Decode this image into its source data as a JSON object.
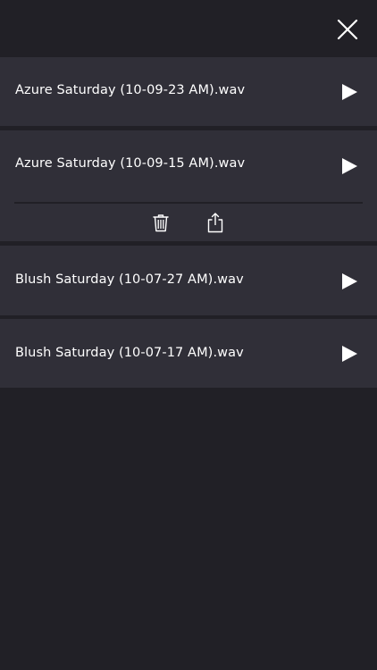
{
  "header": {
    "close_icon": "close-icon"
  },
  "recordings": [
    {
      "filename": "Azure Saturday (10-09-23 AM).wav",
      "expanded": false
    },
    {
      "filename": "Azure Saturday (10-09-15 AM).wav",
      "expanded": true
    },
    {
      "filename": "Blush Saturday (10-07-27 AM).wav",
      "expanded": false
    },
    {
      "filename": "Blush Saturday (10-07-17 AM).wav",
      "expanded": false
    }
  ],
  "icons": {
    "play": "play-icon",
    "delete": "trash-icon",
    "share": "share-icon"
  },
  "colors": {
    "background": "#212026",
    "row": "#302f38",
    "foreground": "#ffffff"
  }
}
